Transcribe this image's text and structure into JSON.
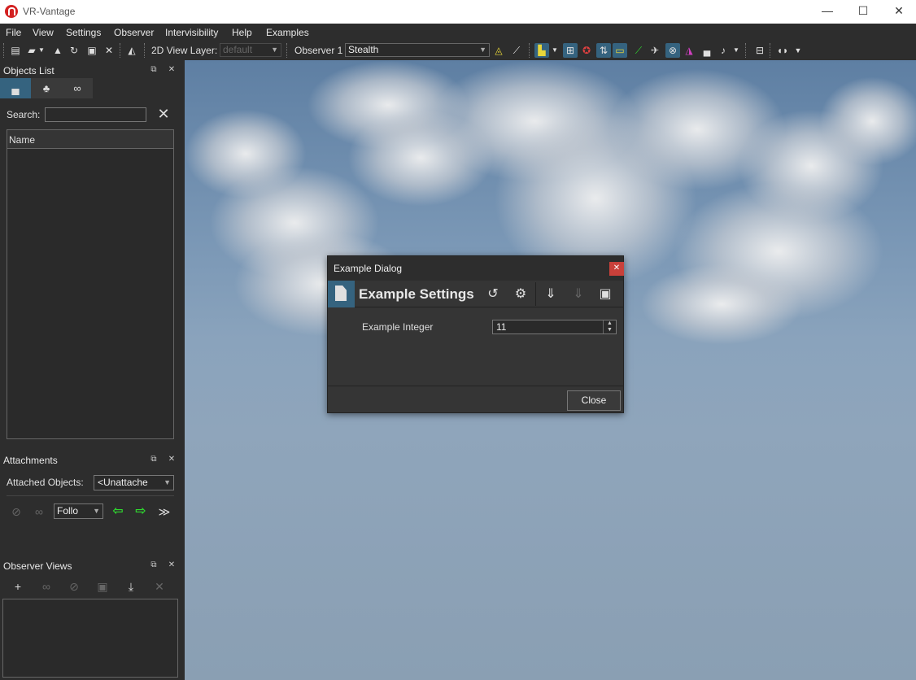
{
  "window": {
    "title": "VR-Vantage",
    "controls": {
      "minimize": "—",
      "maximize": "☐",
      "close": "✕"
    }
  },
  "menubar": {
    "items": [
      "File",
      "View",
      "Settings",
      "Observer",
      "Intervisibility",
      "Help",
      "Examples"
    ]
  },
  "toolbar": {
    "view_layer_label": "2D View Layer:",
    "view_layer_value": "default",
    "observer_label": "Observer 1",
    "observer_value": "Stealth"
  },
  "objects_list": {
    "title": "Objects List",
    "search_label": "Search:",
    "search_value": "",
    "column_header": "Name"
  },
  "attachments": {
    "title": "Attachments",
    "attached_label": "Attached Objects:",
    "attached_value": "<Unattache",
    "follow_value": "Follo"
  },
  "observer_views": {
    "title": "Observer Views"
  },
  "dialog": {
    "title": "Example Dialog",
    "heading": "Example Settings",
    "field_label": "Example Integer",
    "field_value": "11",
    "close_label": "Close"
  },
  "colors": {
    "accent": "#35637f",
    "green_arrow": "#2fd82f",
    "dialog_close": "#c9403a"
  }
}
